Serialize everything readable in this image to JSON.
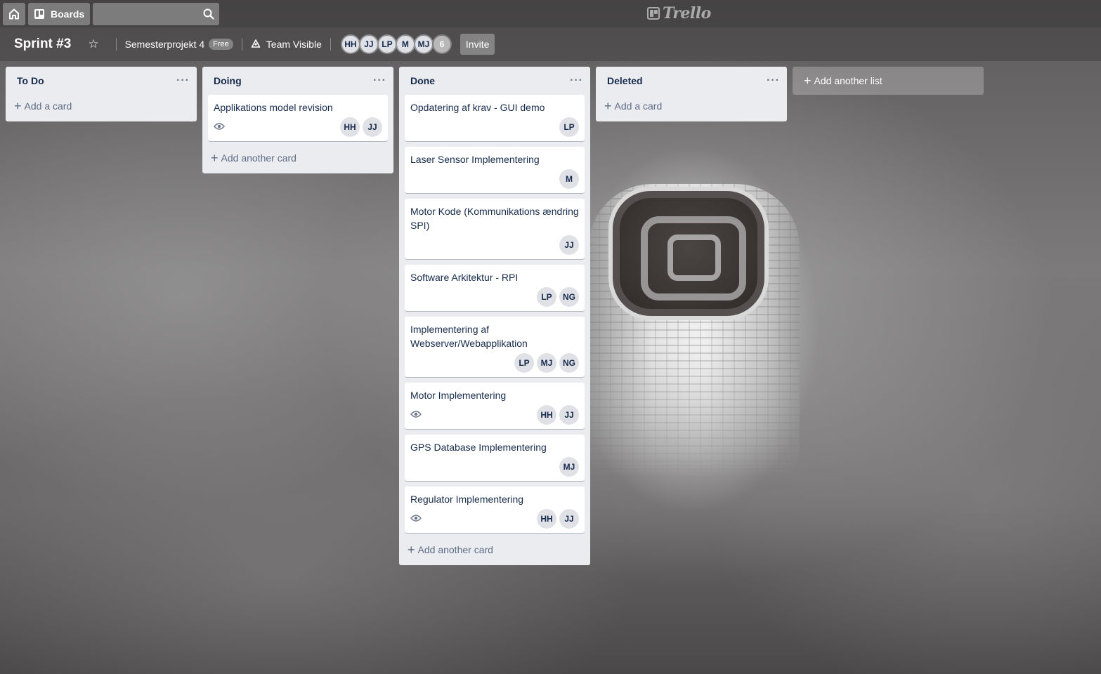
{
  "topbar": {
    "home_icon": "home-icon",
    "boards_label": "Boards",
    "search_value": "",
    "search_placeholder": "",
    "logo_text": "Trello"
  },
  "board": {
    "title": "Sprint #3",
    "team_name": "Semesterprojekt 4",
    "team_badge": "Free",
    "visibility": "Team Visible",
    "members": [
      "HH",
      "JJ",
      "LP",
      "M",
      "MJ"
    ],
    "member_count": "6",
    "invite_label": "Invite"
  },
  "lists": [
    {
      "title": "To Do",
      "menu": "···",
      "cards": [],
      "add_label": "Add a card"
    },
    {
      "title": "Doing",
      "menu": "···",
      "cards": [
        {
          "title": "Applikations model revision",
          "watch": true,
          "members": [
            "HH",
            "JJ"
          ]
        }
      ],
      "add_label": "Add another card"
    },
    {
      "title": "Done",
      "menu": "···",
      "cards": [
        {
          "title": "Opdatering af krav - GUI demo",
          "watch": false,
          "members": [
            "LP"
          ]
        },
        {
          "title": "Laser Sensor Implementering",
          "watch": false,
          "members": [
            "M"
          ]
        },
        {
          "title": "Motor Kode (Kommunikations ændring SPI)",
          "watch": false,
          "members": [
            "JJ"
          ]
        },
        {
          "title": "Software Arkitektur - RPI",
          "watch": false,
          "members": [
            "LP",
            "NG"
          ]
        },
        {
          "title": "Implementering af Webserver/Webapplikation",
          "watch": false,
          "members": [
            "LP",
            "MJ",
            "NG"
          ]
        },
        {
          "title": "Motor Implementering",
          "watch": true,
          "members": [
            "HH",
            "JJ"
          ]
        },
        {
          "title": "GPS Database Implementering",
          "watch": false,
          "members": [
            "MJ"
          ]
        },
        {
          "title": "Regulator Implementering",
          "watch": true,
          "members": [
            "HH",
            "JJ"
          ]
        }
      ],
      "add_label": "Add another card"
    },
    {
      "title": "Deleted",
      "menu": "···",
      "cards": [],
      "add_label": "Add a card"
    }
  ],
  "add_list_label": "Add another list",
  "colors": {
    "list_bg": "#ebecf0",
    "card_text": "#172b4d",
    "muted": "#5e6c84"
  }
}
